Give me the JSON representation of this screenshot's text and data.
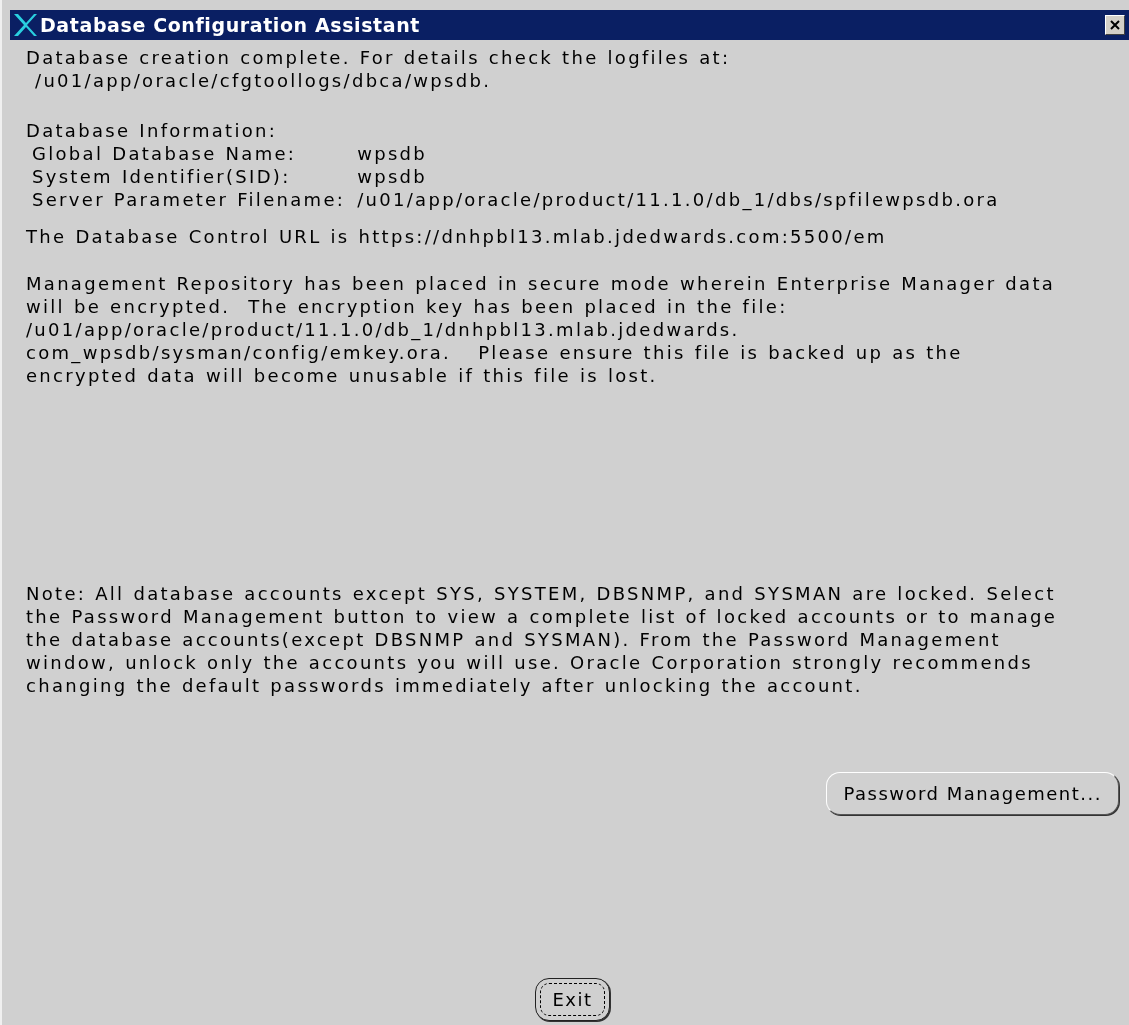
{
  "window": {
    "title": "Database Configuration Assistant"
  },
  "intro": {
    "lines": [
      "Database creation complete. For details check the logfiles at:",
      " /u01/app/oracle/cfgtoollogs/dbca/wpsdb."
    ]
  },
  "database_information": {
    "heading": "Database Information:",
    "rows": [
      {
        "label": "Global Database Name:",
        "value": "wpsdb"
      },
      {
        "label": "System Identifier(SID):",
        "value": "wpsdb"
      },
      {
        "label": "Server Parameter Filename:",
        "value": "/u01/app/oracle/product/11.1.0/db_1/dbs/spfilewpsdb.ora"
      }
    ]
  },
  "control_url": "The Database Control URL is https://dnhpbl13.mlab.jdedwards.com:5500/em",
  "repository_note": {
    "lines": [
      "Management Repository has been placed in secure mode wherein Enterprise Manager data",
      "will be encrypted.  The encryption key has been placed in the file:",
      "/u01/app/oracle/product/11.1.0/db_1/dnhpbl13.mlab.jdedwards.",
      "com_wpsdb/sysman/config/emkey.ora.   Please ensure this file is backed up as the",
      "encrypted data will become unusable if this file is lost."
    ]
  },
  "accounts_note": {
    "lines": [
      "Note: All database accounts except SYS, SYSTEM, DBSNMP, and SYSMAN are locked. Select",
      "the Password Management button to view a complete list of locked accounts or to manage",
      "the database accounts(except DBSNMP and SYSMAN). From the Password Management",
      "window, unlock only the accounts you will use. Oracle Corporation strongly recommends",
      "changing the default passwords immediately after unlocking the account."
    ]
  },
  "password_button": {
    "label": "Password Management...",
    "focused": false
  },
  "exit_button": {
    "label": "Exit",
    "focused": true
  }
}
